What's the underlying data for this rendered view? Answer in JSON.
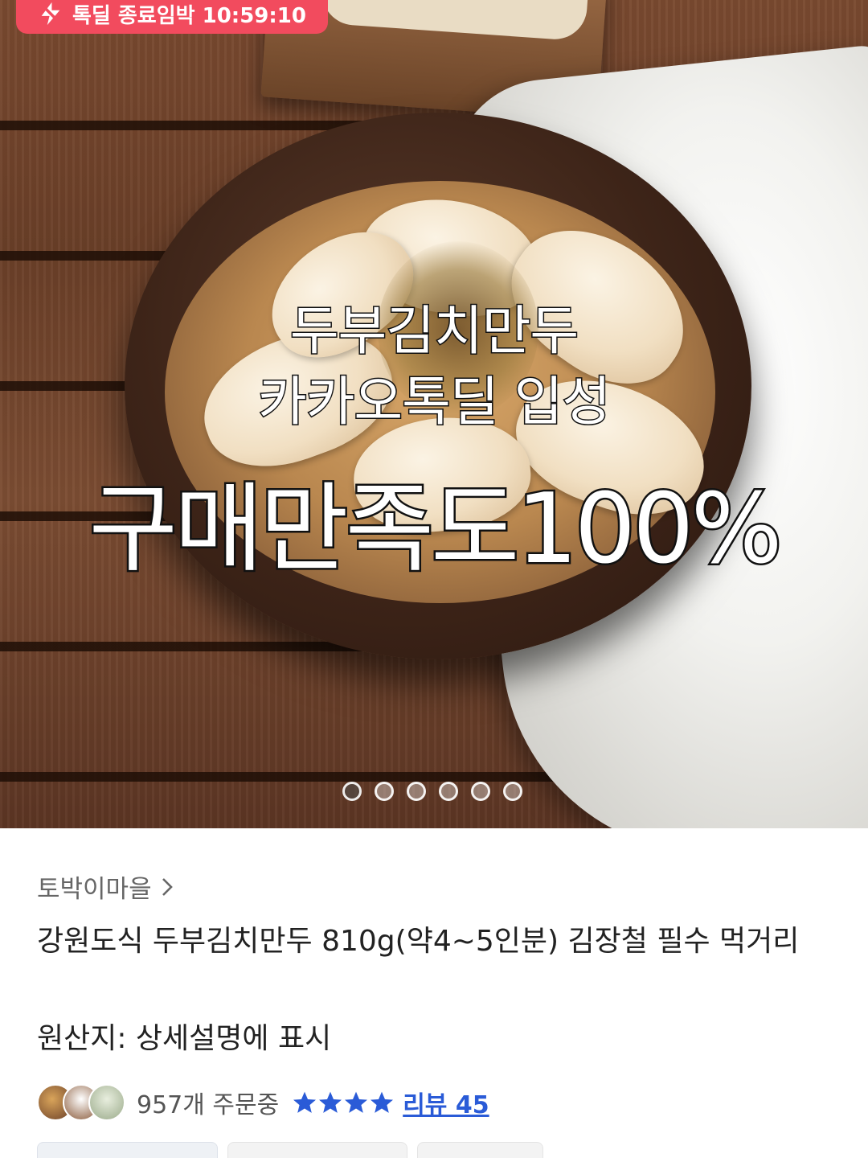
{
  "deal_badge": {
    "label": "톡딜 종료임박 10:59:10",
    "icon": "lightning-icon"
  },
  "hero": {
    "overlay_line1": "두부김치만두",
    "overlay_line2": "카카오톡딜 입성",
    "overlay_line3": "구매만족도100%",
    "carousel": {
      "total": 6,
      "active_index": 0
    }
  },
  "seller": {
    "name": "토박이마을",
    "chevron_icon": "chevron-right-icon"
  },
  "product": {
    "title": "강원도식 두부김치만두 810g(약4~5인분) 김장철 필수 먹거리",
    "origin": "원산지: 상세설명에 표시"
  },
  "stats": {
    "order_count": "957개 주문중",
    "rating_stars": 4,
    "review_label": "리뷰 45"
  },
  "colors": {
    "badge": "#f24b5e",
    "star": "#2a5bd7",
    "link": "#2a5bd7"
  }
}
